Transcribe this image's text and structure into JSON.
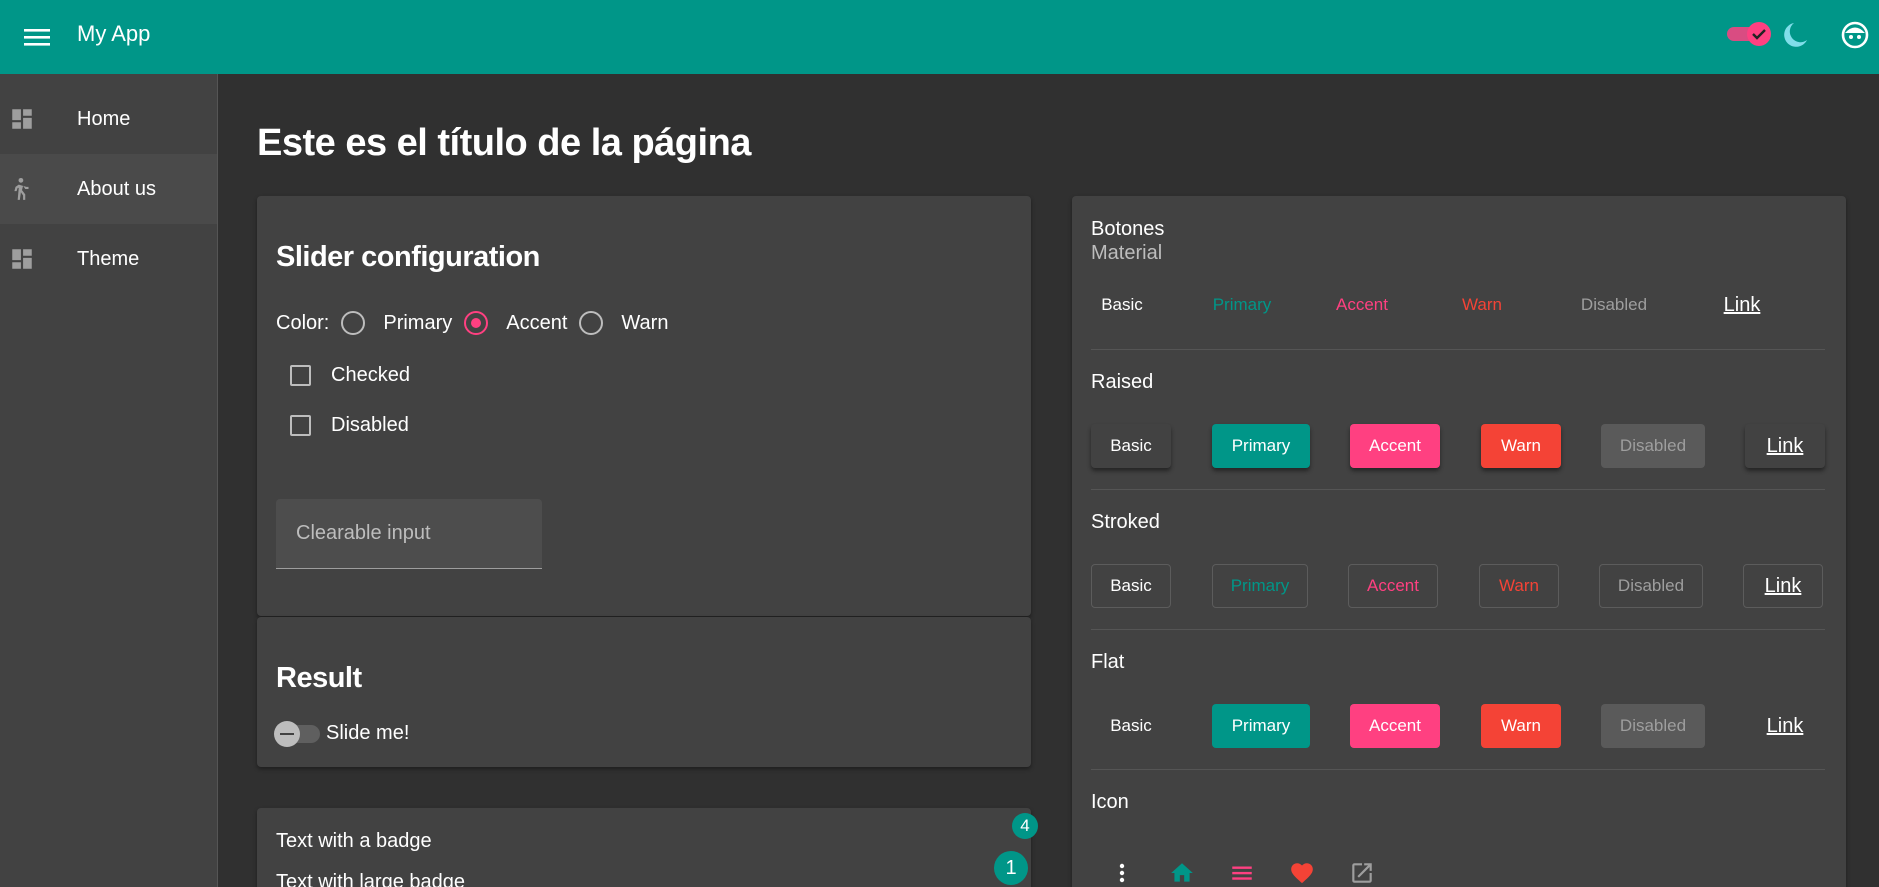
{
  "app": {
    "title": "My App"
  },
  "nav": [
    {
      "label": "Home",
      "icon": "dashboard-icon"
    },
    {
      "label": "About us",
      "icon": "walking-person-icon"
    },
    {
      "label": "Theme",
      "icon": "dashboard-icon"
    }
  ],
  "page": {
    "title": "Este es el título de la página"
  },
  "slider_config": {
    "title": "Slider configuration",
    "color_label": "Color:",
    "colors": [
      "Primary",
      "Accent",
      "Warn"
    ],
    "selected_color": "Accent",
    "checked_label": "Checked",
    "disabled_label": "Disabled",
    "input_placeholder": "Clearable input"
  },
  "result": {
    "title": "Result",
    "slide_label": "Slide me!"
  },
  "badges": {
    "small_text": "Text with a badge",
    "small_count": "4",
    "large_text": "Text with large badge",
    "large_count": "1"
  },
  "buttons": {
    "title": "Botones",
    "subtitle": "Material",
    "sections": [
      "Raised",
      "Stroked",
      "Flat",
      "Icon"
    ],
    "labels": [
      "Basic",
      "Primary",
      "Accent",
      "Warn",
      "Disabled",
      "Link"
    ]
  },
  "colors": {
    "primary": "#009688",
    "accent": "#ff4081",
    "warn": "#f44336",
    "background": "#303030",
    "card": "#424242"
  },
  "icons": [
    "more-vert-icon",
    "home-icon",
    "menu-icon",
    "heart-icon",
    "open-in-new-icon"
  ]
}
